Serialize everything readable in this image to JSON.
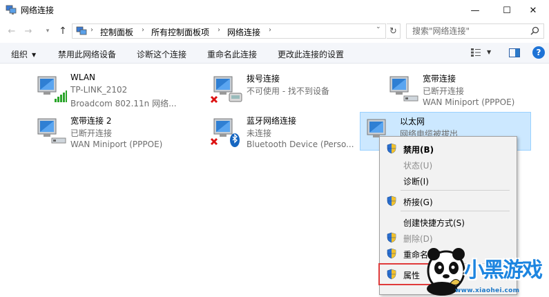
{
  "window": {
    "title": "网络连接",
    "minimize_glyph": "—",
    "maximize_glyph": "☐",
    "close_glyph": "✕"
  },
  "address": {
    "breadcrumbs": [
      "控制面板",
      "所有控制面板项",
      "网络连接"
    ],
    "search_placeholder": "搜索\"网络连接\""
  },
  "toolbar": {
    "organize": "组织",
    "disable": "禁用此网络设备",
    "diagnose": "诊断这个连接",
    "rename": "重命名此连接",
    "change_settings": "更改此连接的设置",
    "help": "?"
  },
  "connections": [
    {
      "name": "WLAN",
      "line2": "TP-LINK_2102",
      "line3": "Broadcom 802.11n 网络...",
      "icon": "wifi-adapter-icon",
      "selected": false
    },
    {
      "name": "拨号连接",
      "line2": "不可使用 - 找不到设备",
      "line3": "",
      "icon": "dialup-adapter-icon",
      "selected": false
    },
    {
      "name": "宽带连接",
      "line2": "已断开连接",
      "line3": "WAN Miniport (PPPOE)",
      "icon": "broadband-adapter-icon",
      "selected": false
    },
    {
      "name": "宽带连接 2",
      "line2": "已断开连接",
      "line3": "WAN Miniport (PPPOE)",
      "icon": "broadband-adapter-icon",
      "selected": false
    },
    {
      "name": "蓝牙网络连接",
      "line2": "未连接",
      "line3": "Bluetooth Device (Perso...",
      "icon": "bluetooth-adapter-icon",
      "selected": false
    },
    {
      "name": "以太网",
      "line2": "网络电缆被拔出",
      "line3": "",
      "icon": "ethernet-adapter-icon",
      "selected": true
    }
  ],
  "context_menu": {
    "items": [
      {
        "label": "禁用(B)",
        "shield": true,
        "disabled": false,
        "bold": true
      },
      {
        "label": "状态(U)",
        "shield": false,
        "disabled": true
      },
      {
        "label": "诊断(I)",
        "shield": false,
        "disabled": false
      },
      {
        "label": "桥接(G)",
        "shield": true,
        "disabled": false
      },
      {
        "label": "创建快捷方式(S)",
        "shield": false,
        "disabled": false
      },
      {
        "label": "删除(D)",
        "shield": true,
        "disabled": true
      },
      {
        "label": "重命名(M)",
        "shield": true,
        "disabled": false
      },
      {
        "label": "属性",
        "shield": true,
        "disabled": false
      }
    ]
  },
  "watermark": {
    "logo_text": "小黑游戏",
    "url": "www.xiaohei.com"
  },
  "colors": {
    "selection_bg": "#cce8ff",
    "selection_border": "#99d1ff",
    "highlight_box": "#e03a3a",
    "accent_blue": "#1e73d6"
  }
}
